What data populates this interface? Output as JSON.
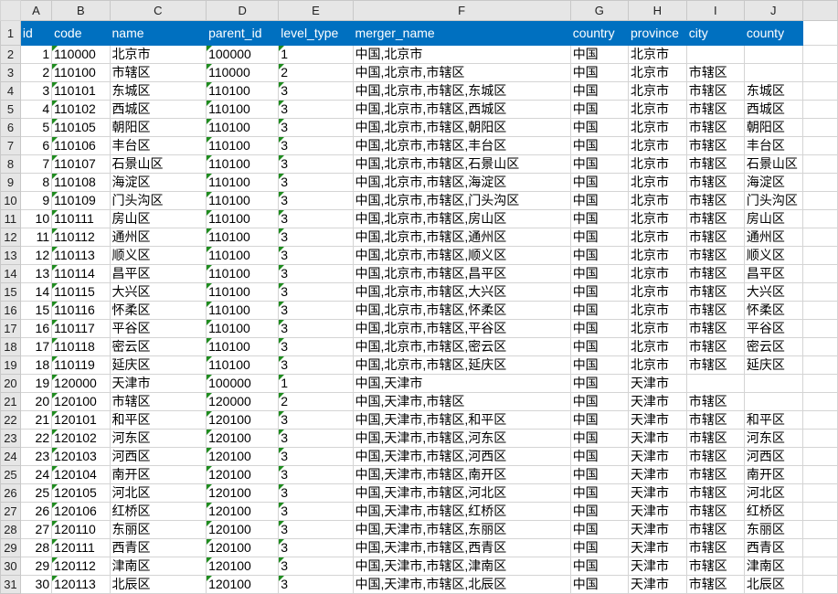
{
  "columns": [
    "A",
    "B",
    "C",
    "D",
    "E",
    "F",
    "G",
    "H",
    "I",
    "J",
    ""
  ],
  "headers": [
    "id",
    "code",
    "name",
    "parent_id",
    "level_type",
    "merger_name",
    "country",
    "province",
    "city",
    "county"
  ],
  "rows": [
    [
      "1",
      "110000",
      "北京市",
      "100000",
      "1",
      "中国,北京市",
      "中国",
      "北京市",
      "",
      ""
    ],
    [
      "2",
      "110100",
      "市辖区",
      "110000",
      "2",
      "中国,北京市,市辖区",
      "中国",
      "北京市",
      "市辖区",
      ""
    ],
    [
      "3",
      "110101",
      "东城区",
      "110100",
      "3",
      "中国,北京市,市辖区,东城区",
      "中国",
      "北京市",
      "市辖区",
      "东城区"
    ],
    [
      "4",
      "110102",
      "西城区",
      "110100",
      "3",
      "中国,北京市,市辖区,西城区",
      "中国",
      "北京市",
      "市辖区",
      "西城区"
    ],
    [
      "5",
      "110105",
      "朝阳区",
      "110100",
      "3",
      "中国,北京市,市辖区,朝阳区",
      "中国",
      "北京市",
      "市辖区",
      "朝阳区"
    ],
    [
      "6",
      "110106",
      "丰台区",
      "110100",
      "3",
      "中国,北京市,市辖区,丰台区",
      "中国",
      "北京市",
      "市辖区",
      "丰台区"
    ],
    [
      "7",
      "110107",
      "石景山区",
      "110100",
      "3",
      "中国,北京市,市辖区,石景山区",
      "中国",
      "北京市",
      "市辖区",
      "石景山区"
    ],
    [
      "8",
      "110108",
      "海淀区",
      "110100",
      "3",
      "中国,北京市,市辖区,海淀区",
      "中国",
      "北京市",
      "市辖区",
      "海淀区"
    ],
    [
      "9",
      "110109",
      "门头沟区",
      "110100",
      "3",
      "中国,北京市,市辖区,门头沟区",
      "中国",
      "北京市",
      "市辖区",
      "门头沟区"
    ],
    [
      "10",
      "110111",
      "房山区",
      "110100",
      "3",
      "中国,北京市,市辖区,房山区",
      "中国",
      "北京市",
      "市辖区",
      "房山区"
    ],
    [
      "11",
      "110112",
      "通州区",
      "110100",
      "3",
      "中国,北京市,市辖区,通州区",
      "中国",
      "北京市",
      "市辖区",
      "通州区"
    ],
    [
      "12",
      "110113",
      "顺义区",
      "110100",
      "3",
      "中国,北京市,市辖区,顺义区",
      "中国",
      "北京市",
      "市辖区",
      "顺义区"
    ],
    [
      "13",
      "110114",
      "昌平区",
      "110100",
      "3",
      "中国,北京市,市辖区,昌平区",
      "中国",
      "北京市",
      "市辖区",
      "昌平区"
    ],
    [
      "14",
      "110115",
      "大兴区",
      "110100",
      "3",
      "中国,北京市,市辖区,大兴区",
      "中国",
      "北京市",
      "市辖区",
      "大兴区"
    ],
    [
      "15",
      "110116",
      "怀柔区",
      "110100",
      "3",
      "中国,北京市,市辖区,怀柔区",
      "中国",
      "北京市",
      "市辖区",
      "怀柔区"
    ],
    [
      "16",
      "110117",
      "平谷区",
      "110100",
      "3",
      "中国,北京市,市辖区,平谷区",
      "中国",
      "北京市",
      "市辖区",
      "平谷区"
    ],
    [
      "17",
      "110118",
      "密云区",
      "110100",
      "3",
      "中国,北京市,市辖区,密云区",
      "中国",
      "北京市",
      "市辖区",
      "密云区"
    ],
    [
      "18",
      "110119",
      "延庆区",
      "110100",
      "3",
      "中国,北京市,市辖区,延庆区",
      "中国",
      "北京市",
      "市辖区",
      "延庆区"
    ],
    [
      "19",
      "120000",
      "天津市",
      "100000",
      "1",
      "中国,天津市",
      "中国",
      "天津市",
      "",
      ""
    ],
    [
      "20",
      "120100",
      "市辖区",
      "120000",
      "2",
      "中国,天津市,市辖区",
      "中国",
      "天津市",
      "市辖区",
      ""
    ],
    [
      "21",
      "120101",
      "和平区",
      "120100",
      "3",
      "中国,天津市,市辖区,和平区",
      "中国",
      "天津市",
      "市辖区",
      "和平区"
    ],
    [
      "22",
      "120102",
      "河东区",
      "120100",
      "3",
      "中国,天津市,市辖区,河东区",
      "中国",
      "天津市",
      "市辖区",
      "河东区"
    ],
    [
      "23",
      "120103",
      "河西区",
      "120100",
      "3",
      "中国,天津市,市辖区,河西区",
      "中国",
      "天津市",
      "市辖区",
      "河西区"
    ],
    [
      "24",
      "120104",
      "南开区",
      "120100",
      "3",
      "中国,天津市,市辖区,南开区",
      "中国",
      "天津市",
      "市辖区",
      "南开区"
    ],
    [
      "25",
      "120105",
      "河北区",
      "120100",
      "3",
      "中国,天津市,市辖区,河北区",
      "中国",
      "天津市",
      "市辖区",
      "河北区"
    ],
    [
      "26",
      "120106",
      "红桥区",
      "120100",
      "3",
      "中国,天津市,市辖区,红桥区",
      "中国",
      "天津市",
      "市辖区",
      "红桥区"
    ],
    [
      "27",
      "120110",
      "东丽区",
      "120100",
      "3",
      "中国,天津市,市辖区,东丽区",
      "中国",
      "天津市",
      "市辖区",
      "东丽区"
    ],
    [
      "28",
      "120111",
      "西青区",
      "120100",
      "3",
      "中国,天津市,市辖区,西青区",
      "中国",
      "天津市",
      "市辖区",
      "西青区"
    ],
    [
      "29",
      "120112",
      "津南区",
      "120100",
      "3",
      "中国,天津市,市辖区,津南区",
      "中国",
      "天津市",
      "市辖区",
      "津南区"
    ],
    [
      "30",
      "120113",
      "北辰区",
      "120100",
      "3",
      "中国,天津市,市辖区,北辰区",
      "中国",
      "天津市",
      "市辖区",
      "北辰区"
    ]
  ],
  "colors": {
    "header_fill": "#0070c0",
    "header_text": "#ffffff",
    "error_indicator": "#1f8c1f"
  }
}
